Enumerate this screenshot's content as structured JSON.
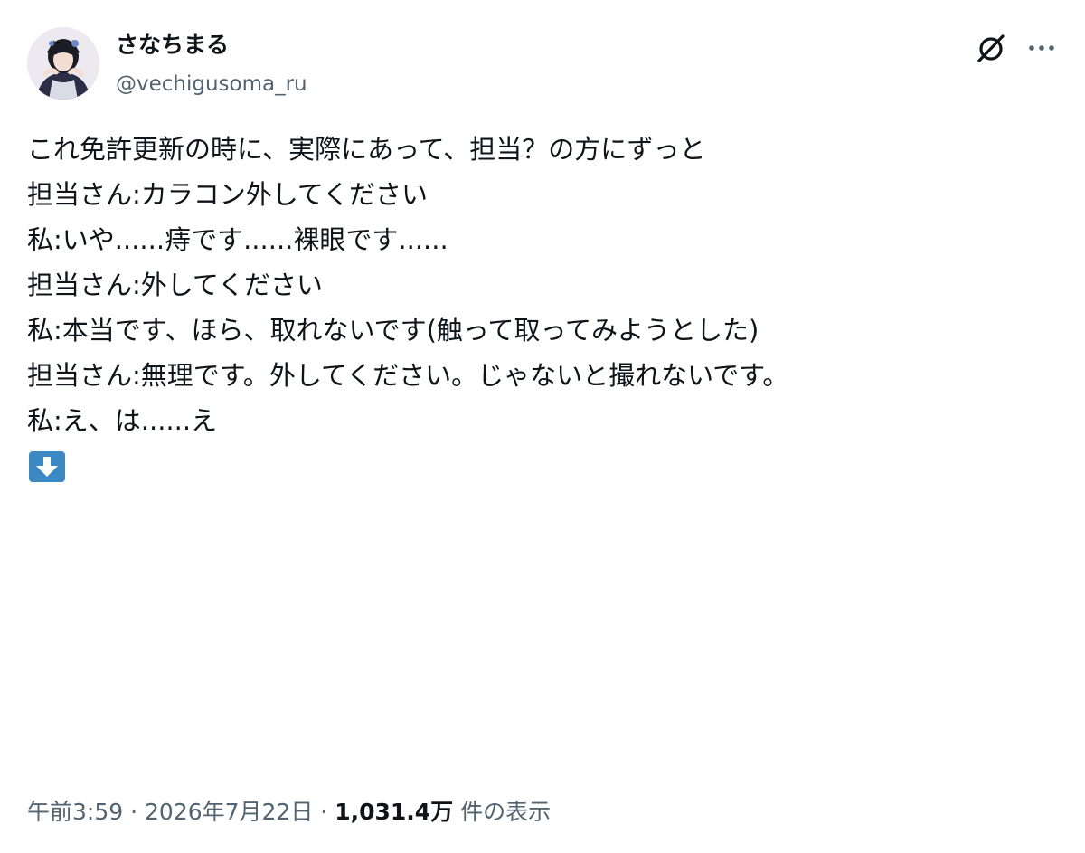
{
  "author": {
    "display_name": "さなちまる",
    "handle": "@vechigusoma_ru"
  },
  "header_actions": {
    "grok_icon": "grok-icon",
    "more_icon": "more-options-icon"
  },
  "tweet": {
    "lines": [
      "これ免許更新の時に、実際にあって、担当？の方にずっと",
      "担当さん:カラコン外してください",
      "私:いや......痔です......裸眼です......",
      "担当さん:外してください",
      "私:本当です、ほら、取れないです(触って取ってみようとした)",
      "担当さん:無理です。外してください。じゃないと撮れないです。",
      "私:え、は......え"
    ],
    "trailing_emoji": "down-arrow-emoji"
  },
  "meta": {
    "time": "午前3:59",
    "separator": "·",
    "date": "2026年7月22日",
    "views_count": "1,031.4万",
    "views_label": "件の表示"
  }
}
